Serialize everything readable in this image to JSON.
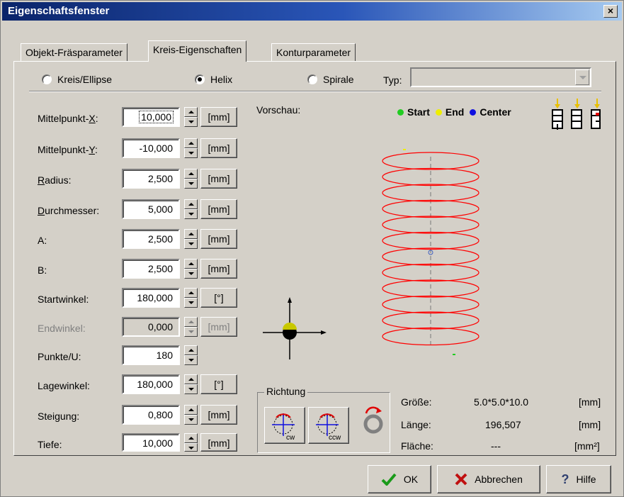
{
  "window": {
    "title": "Eigenschaftsfenster",
    "close_label": "×"
  },
  "tabs": [
    {
      "label": "Objekt-Fräsparameter"
    },
    {
      "label": "Kreis-Eigenschaften"
    },
    {
      "label": "Konturparameter"
    }
  ],
  "mode": {
    "options": [
      "Kreis/Ellipse",
      "Helix",
      "Spirale"
    ],
    "selected": "Helix",
    "typ_label": "Typ:",
    "typ_value": ""
  },
  "fields": [
    {
      "label_pre": "Mittelpunkt-",
      "label_u": "X",
      "label_post": ":",
      "value": "10,000",
      "unit": "[mm]"
    },
    {
      "label_pre": "Mittelpunkt-",
      "label_u": "Y",
      "label_post": ":",
      "value": "-10,000",
      "unit": "[mm]"
    },
    {
      "label_pre": "",
      "label_u": "R",
      "label_post": "adius:",
      "value": "2,500",
      "unit": "[mm]"
    },
    {
      "label_pre": "",
      "label_u": "D",
      "label_post": "urchmesser:",
      "value": "5,000",
      "unit": "[mm]"
    },
    {
      "label_pre": "A:",
      "label_u": "",
      "label_post": "",
      "value": "2,500",
      "unit": "[mm]"
    },
    {
      "label_pre": "B:",
      "label_u": "",
      "label_post": "",
      "value": "2,500",
      "unit": "[mm]"
    },
    {
      "label_pre": "Startwinkel:",
      "label_u": "",
      "label_post": "",
      "value": "180,000",
      "unit": "[°]"
    },
    {
      "label_pre": "Endwinkel:",
      "label_u": "",
      "label_post": "",
      "value": "0,000",
      "unit": "[mm]"
    },
    {
      "label_pre": "Punkte/U:",
      "label_u": "",
      "label_post": "",
      "value": "180",
      "unit": ""
    },
    {
      "label_pre": "Lagewinkel:",
      "label_u": "",
      "label_post": "",
      "value": "180,000",
      "unit": "[°]"
    },
    {
      "label_pre": "Steigung:",
      "label_u": "",
      "label_post": "",
      "value": "0,800",
      "unit": "[mm]"
    },
    {
      "label_pre": "Tiefe:",
      "label_u": "",
      "label_post": "",
      "value": "10,000",
      "unit": "[mm]"
    }
  ],
  "preview": {
    "label": "Vorschau:",
    "legend": [
      {
        "label": "Start",
        "color": "#22cc22"
      },
      {
        "label": "End",
        "color": "#eeee00"
      },
      {
        "label": "Center",
        "color": "#1010e0"
      }
    ],
    "helix_color": "#ff0000"
  },
  "direction": {
    "title": "Richtung",
    "cw_label": "cw",
    "ccw_label": "ccw"
  },
  "info": [
    {
      "label": "Größe:",
      "value": "5.0*5.0*10.0",
      "unit": "[mm]"
    },
    {
      "label": "Länge:",
      "value": "196,507",
      "unit": "[mm]"
    },
    {
      "label": "Fläche:",
      "value": "---",
      "unit": "[mm²]"
    }
  ],
  "buttons": {
    "ok": "OK",
    "cancel": "Abbrechen",
    "help": "Hilfe"
  }
}
